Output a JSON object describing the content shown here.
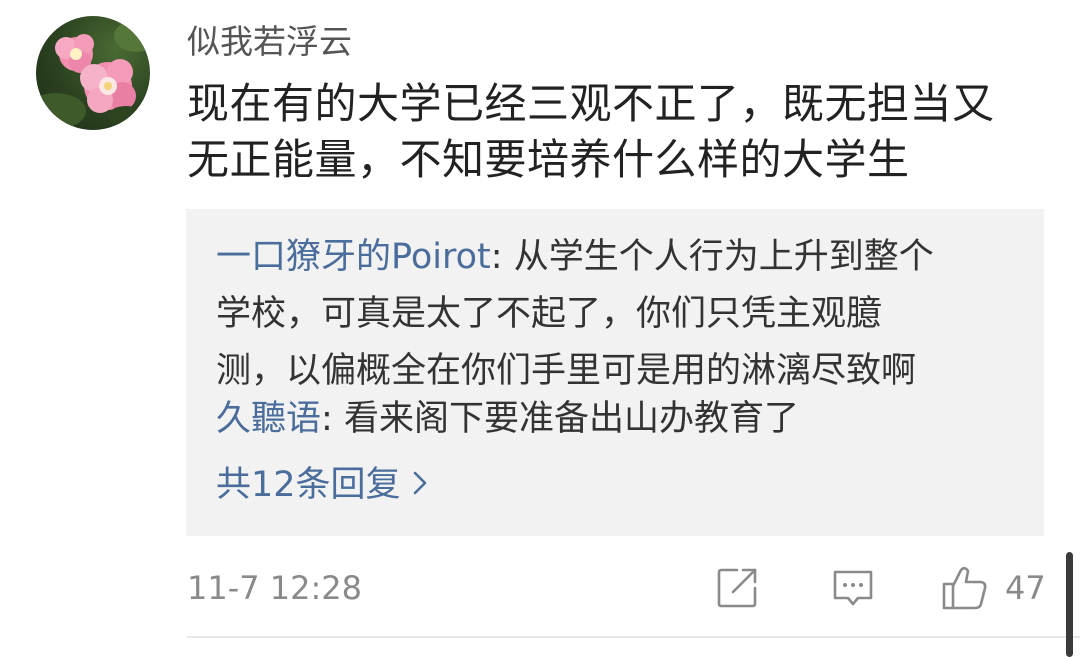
{
  "comment": {
    "username": "似我若浮云",
    "text_lines": [
      "现在有的大学已经三观不正了，既无担当又",
      "无正能量，不知要培养什么样的大学生"
    ],
    "avatar_icon": "pink-flower-avatar"
  },
  "replies": [
    {
      "author": "一口獠牙的Poirot",
      "separator": ": ",
      "lines": [
        "从学生个人行为上升到整个",
        "学校，可真是太了不起了，你们只凭主观臆",
        "测，以偏概全在你们手里可是用的淋漓尽致啊"
      ]
    },
    {
      "author": "久聽语",
      "separator": ": ",
      "lines": [
        "看来阁下要准备出山办教育了"
      ]
    }
  ],
  "more_replies_label": "共12条回复",
  "meta": {
    "timestamp": "11-7 12:28",
    "like_count": "47",
    "icons": [
      "share-icon",
      "comment-icon",
      "like-icon"
    ]
  },
  "colors": {
    "author_link": "#4a6d9c",
    "reply_background": "#f2f2f2",
    "body_text": "#222222",
    "meta_text": "#8a8a8a"
  }
}
